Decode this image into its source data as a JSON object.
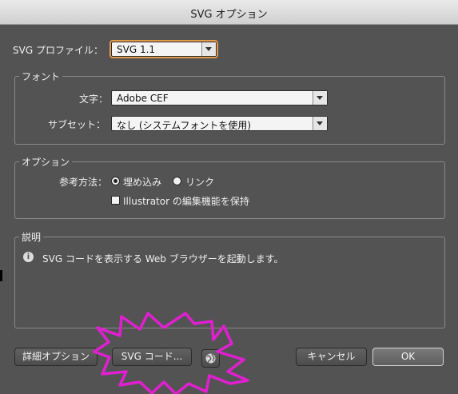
{
  "window": {
    "title": "SVG オプション"
  },
  "profile": {
    "label": "SVG プロファイル：",
    "value": "SVG 1.1"
  },
  "font_group": {
    "title": "フォント",
    "type_label": "文字：",
    "type_value": "Adobe CEF",
    "subset_label": "サブセット：",
    "subset_value": "なし (システムフォントを使用)"
  },
  "options_group": {
    "title": "オプション",
    "method_label": "参考方法：",
    "embed_label": "埋め込み",
    "link_label": "リンク",
    "embed_selected": true,
    "preserve_label": "Illustrator の編集機能を保持",
    "preserve_checked": false
  },
  "description_group": {
    "title": "説明",
    "text": "SVG コードを表示する Web ブラウザーを起動します。"
  },
  "buttons": {
    "more_options": "詳細オプション",
    "svg_code": "SVG コード...",
    "cancel": "キャンセル",
    "ok": "OK"
  },
  "colors": {
    "dialog_bg": "#535353",
    "annotation": "#e020d0",
    "focus_ring": "#e39a4a"
  },
  "icons": {
    "info": "info-icon",
    "globe": "globe-icon",
    "dropdown": "chevron-down-icon"
  }
}
